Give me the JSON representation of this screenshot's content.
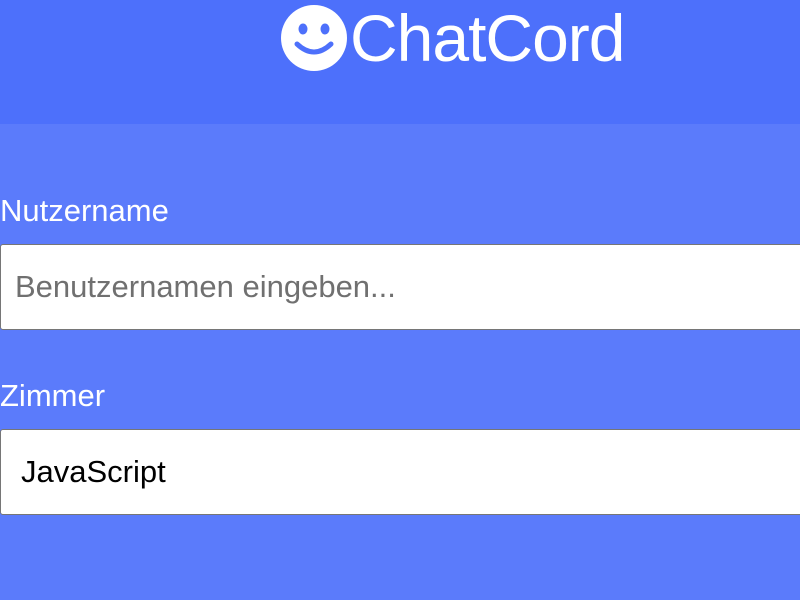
{
  "header": {
    "app_name": "ChatCord",
    "logo_icon": "smile-icon",
    "background_color": "#4d70fb"
  },
  "form": {
    "background_color": "#5b7bfb",
    "username": {
      "label": "Nutzername",
      "value": "",
      "placeholder": "Benutzernamen eingeben..."
    },
    "room": {
      "label": "Zimmer",
      "selected": "JavaScript"
    }
  }
}
